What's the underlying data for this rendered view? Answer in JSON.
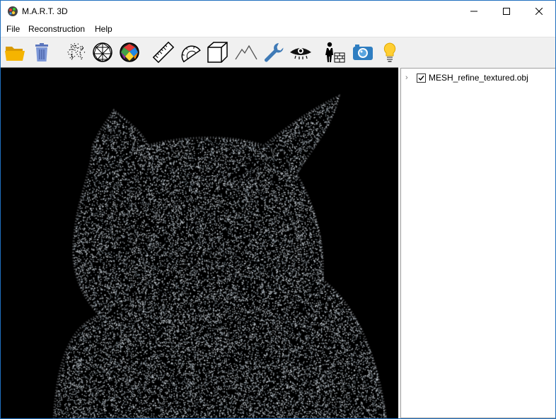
{
  "window": {
    "title": "M.A.R.T. 3D"
  },
  "menu": {
    "items": [
      "File",
      "Reconstruction",
      "Help"
    ]
  },
  "toolbar": {
    "tools": [
      {
        "icon": "folder-open-icon"
      },
      {
        "icon": "trash-icon"
      },
      {
        "icon": "point-cloud-icon"
      },
      {
        "icon": "wireframe-sphere-icon"
      },
      {
        "icon": "textured-sphere-icon"
      },
      {
        "icon": "ruler-icon"
      },
      {
        "icon": "protractor-icon"
      },
      {
        "icon": "cube-icon"
      },
      {
        "icon": "mountain-icon"
      },
      {
        "icon": "wrench-icon"
      },
      {
        "icon": "eye-icon"
      },
      {
        "icon": "builder-icon"
      },
      {
        "icon": "camera-icon"
      },
      {
        "icon": "lightbulb-icon"
      }
    ]
  },
  "tree": {
    "items": [
      {
        "label": "MESH_refine_textured.obj",
        "checked": true
      }
    ]
  },
  "colors": {
    "folder": "#f5b400",
    "trash": "#6f8bd0",
    "accent": "#2f7ec1",
    "viewport_bg": "#000000",
    "point": "#cfd6dc"
  }
}
